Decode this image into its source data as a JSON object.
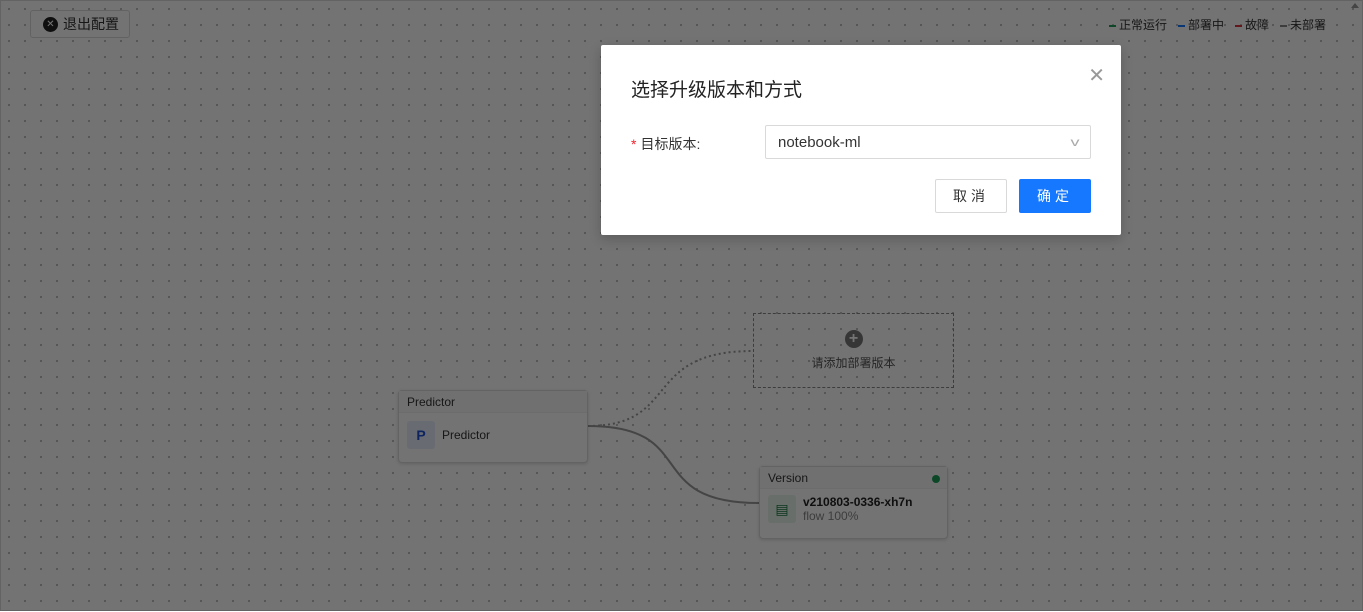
{
  "toolbar": {
    "exit_label": "退出配置",
    "exit_icon": "close-circle-icon"
  },
  "legend": [
    {
      "label": "正常运行",
      "color": "#1aa05a"
    },
    {
      "label": "部署中",
      "color": "#1677ff"
    },
    {
      "label": "故障",
      "color": "#e0303a"
    },
    {
      "label": "未部署",
      "color": "#888888"
    }
  ],
  "canvas": {
    "predictor_node": {
      "header": "Predictor",
      "name": "Predictor",
      "icon": "predictor-icon"
    },
    "add_version": {
      "label": "请添加部署版本",
      "icon": "plus-circle-icon"
    },
    "version_node": {
      "header": "Version",
      "name": "v210803-0336-xh7n",
      "flow": "flow 100%",
      "status_color": "#1aa05a",
      "icon": "version-file-icon"
    }
  },
  "modal": {
    "title": "选择升级版本和方式",
    "field_label": "目标版本:",
    "required_mark": "*",
    "selected_value": "notebook-ml",
    "cancel_label": "取消",
    "ok_label": "确定"
  }
}
